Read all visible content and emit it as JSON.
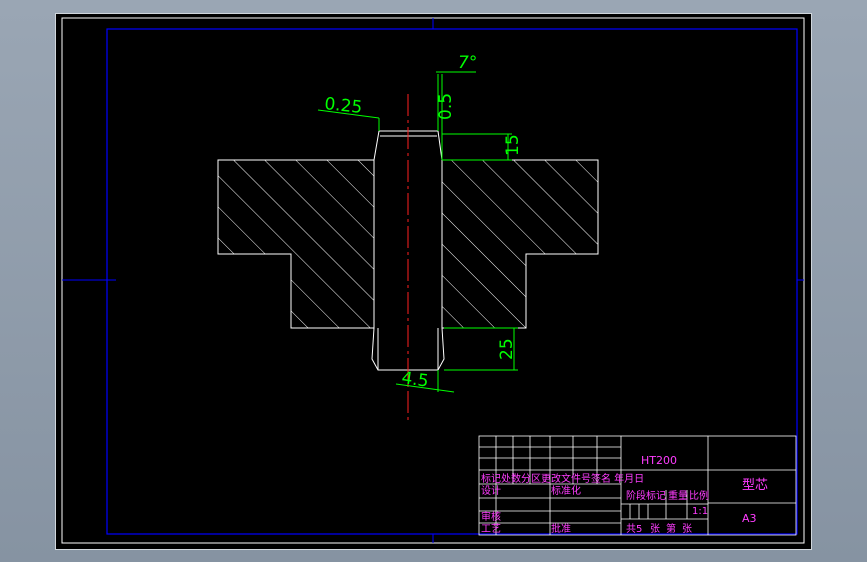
{
  "dimensions": {
    "angle": "7°",
    "chamfer_top": "0.25",
    "top_small": "0.5",
    "top_height": "15",
    "bottom_height": "25",
    "bottom_width": "4.5"
  },
  "title_block": {
    "material": "HT200",
    "part_name": "型芯",
    "sheet_size": "A3",
    "scale": "1:1",
    "row_labels": [
      "标记处数分区更改文件号签名 年月日",
      "设计",
      "审核",
      "工艺"
    ],
    "standardize": "标准化",
    "approve": "批准",
    "stage_headers": [
      "阶段标记",
      "重量",
      "比例"
    ],
    "sheet_info": [
      "共5",
      "张",
      "第",
      "张"
    ]
  },
  "colors": {
    "background": "#000000",
    "frame": "#0000ff",
    "outline": "#ffffff",
    "dimension": "#00ff00",
    "centerline": "#ff0000",
    "title_text": "#ff3cff"
  }
}
